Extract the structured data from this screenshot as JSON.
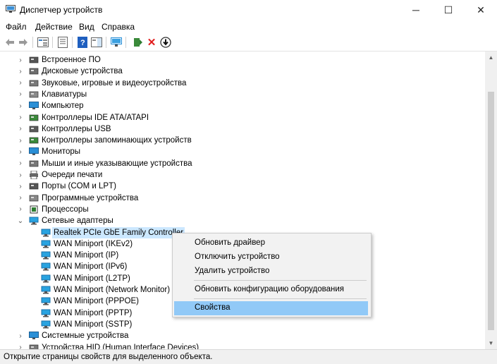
{
  "window": {
    "title": "Диспетчер устройств",
    "controls": [
      "─",
      "☐",
      "✕"
    ]
  },
  "menu": [
    "Файл",
    "Действие",
    "Вид",
    "Справка"
  ],
  "tree": [
    {
      "label": "Встроенное ПО",
      "icon": "firmware-icon",
      "color": "#555555"
    },
    {
      "label": "Дисковые устройства",
      "icon": "disk-drive-icon",
      "color": "#6d6d6d"
    },
    {
      "label": "Звуковые, игровые и видеоустройства",
      "icon": "speaker-icon",
      "color": "#7a7a7a"
    },
    {
      "label": "Клавиатуры",
      "icon": "keyboard-icon",
      "color": "#8a8a8a"
    },
    {
      "label": "Компьютер",
      "icon": "computer-icon",
      "color": "#2a8fd6"
    },
    {
      "label": "Контроллеры IDE ATA/ATAPI",
      "icon": "ide-controller-icon",
      "color": "#3a8a3a"
    },
    {
      "label": "Контроллеры USB",
      "icon": "usb-icon",
      "color": "#5a5a5a"
    },
    {
      "label": "Контроллеры запоминающих устройств",
      "icon": "storage-controller-icon",
      "color": "#3a8a3a"
    },
    {
      "label": "Мониторы",
      "icon": "monitor-icon",
      "color": "#2a8fd6"
    },
    {
      "label": "Мыши и иные указывающие устройства",
      "icon": "mouse-icon",
      "color": "#777777"
    },
    {
      "label": "Очереди печати",
      "icon": "printer-icon",
      "color": "#666666"
    },
    {
      "label": "Порты (COM и LPT)",
      "icon": "port-icon",
      "color": "#555555"
    },
    {
      "label": "Программные устройства",
      "icon": "software-device-icon",
      "color": "#888888"
    },
    {
      "label": "Процессоры",
      "icon": "processor-icon",
      "color": "#2e7d32"
    },
    {
      "label": "Сетевые адаптеры",
      "icon": "network-adapter-icon",
      "color": "#2a8fd6",
      "expanded": true
    }
  ],
  "network_children": [
    "Realtek PCIe GbE Family Controller",
    "WAN Miniport (IKEv2)",
    "WAN Miniport (IP)",
    "WAN Miniport (IPv6)",
    "WAN Miniport (L2TP)",
    "WAN Miniport (Network Monitor)",
    "WAN Miniport (PPPOE)",
    "WAN Miniport (PPTP)",
    "WAN Miniport (SSTP)"
  ],
  "tree_tail": [
    {
      "label": "Системные устройства",
      "icon": "system-device-icon",
      "color": "#2a8fd6"
    },
    {
      "label": "Устройства HID (Human Interface Devices)",
      "icon": "hid-icon",
      "color": "#777777"
    }
  ],
  "context_menu": {
    "items": [
      "Обновить драйвер",
      "Отключить устройство",
      "Удалить устройство",
      "Обновить конфигурацию оборудования",
      "Свойства"
    ],
    "highlighted": 4
  },
  "status": "Открытие страницы свойств для выделенного объекта.",
  "colors": {
    "selection": "#cce8ff",
    "menu_highlight": "#91c9f7",
    "network_icon": "#29a3e0"
  }
}
